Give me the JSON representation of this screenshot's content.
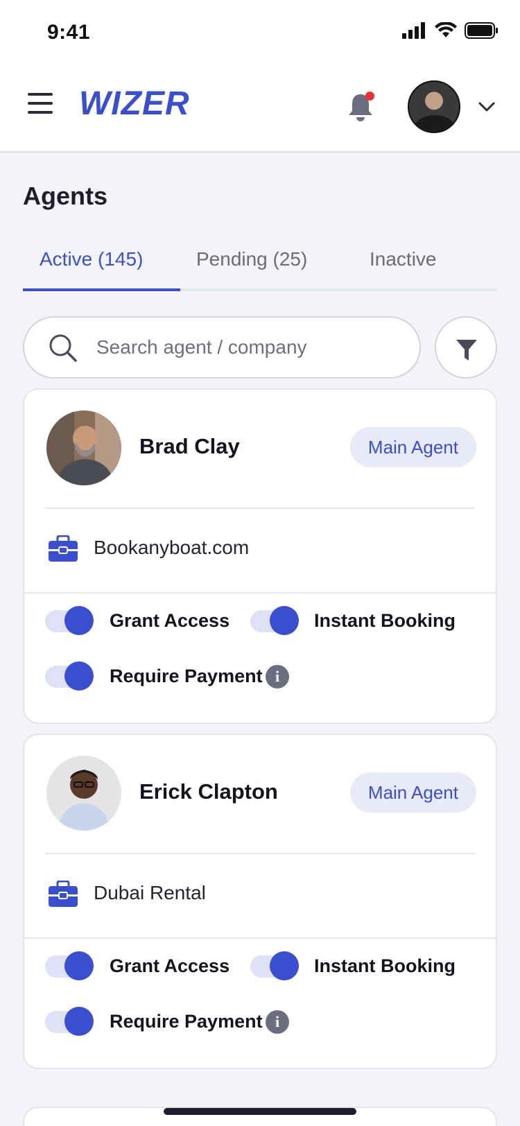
{
  "status_bar": {
    "time": "9:41"
  },
  "header": {
    "logo": "WIZER",
    "notification_dot_color": "#e3342f"
  },
  "page": {
    "title": "Agents"
  },
  "tabs": [
    {
      "label": "Active (145)",
      "active": true
    },
    {
      "label": "Pending (25)",
      "active": false
    },
    {
      "label": "Inactive",
      "active": false
    }
  ],
  "search": {
    "placeholder": "Search agent / company",
    "value": ""
  },
  "agents": [
    {
      "name": "Brad Clay",
      "role": "Main Agent",
      "company": "Bookanyboat.com",
      "toggles": [
        {
          "label": "Grant Access",
          "on": true
        },
        {
          "label": "Instant Booking",
          "on": true
        },
        {
          "label": "Require Payment",
          "on": true
        }
      ]
    },
    {
      "name": "Erick Clapton",
      "role": "Main Agent",
      "company": "Dubai Rental",
      "toggles": [
        {
          "label": "Grant Access",
          "on": true
        },
        {
          "label": "Instant Booking",
          "on": true
        },
        {
          "label": "Require Payment",
          "on": true
        }
      ]
    }
  ],
  "colors": {
    "accent": "#3a4fcf",
    "badge_bg": "#e8eaf8",
    "toggle_track": "#dfe2f7"
  }
}
